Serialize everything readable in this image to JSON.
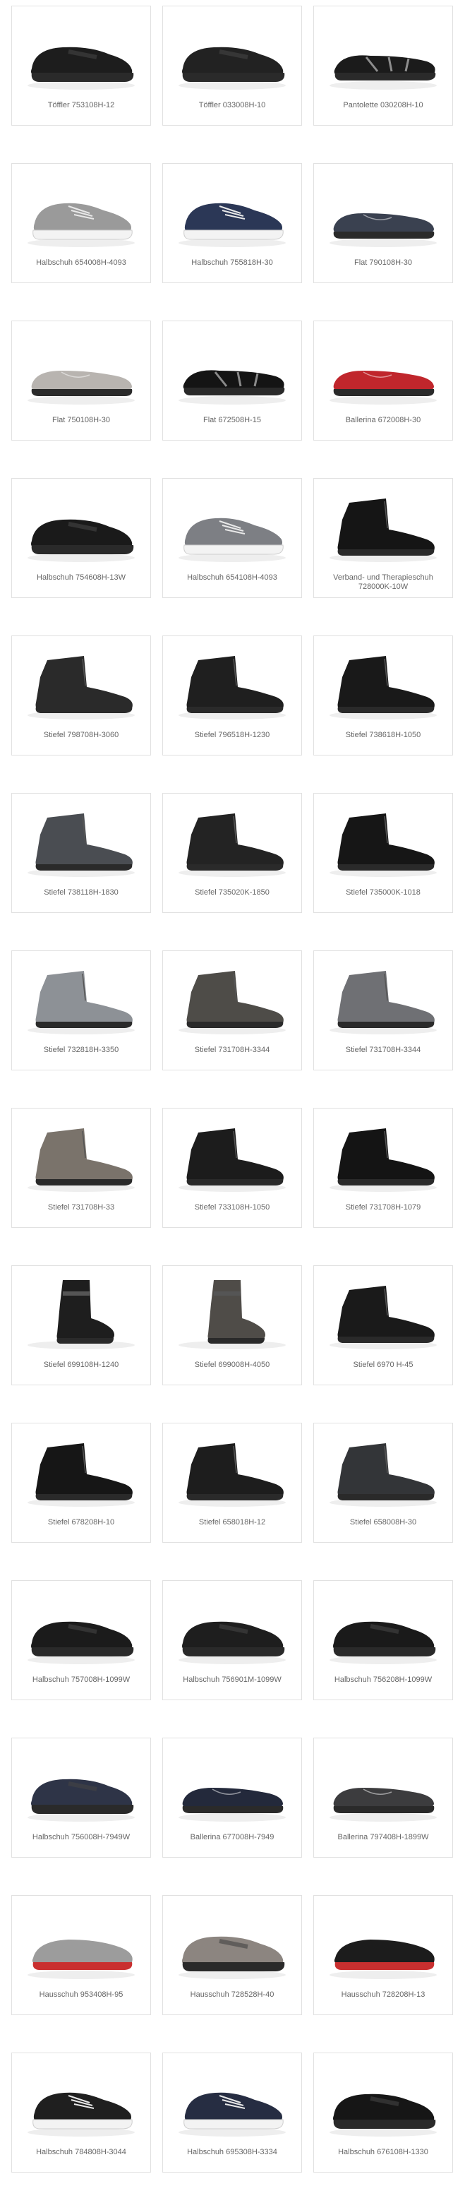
{
  "products": [
    {
      "name": "Töffler 753108H-12",
      "type": "slipon",
      "color": "#1d1d1d"
    },
    {
      "name": "Töffler 033008H-10",
      "type": "slipon",
      "color": "#222222"
    },
    {
      "name": "Pantolette 030208H-10",
      "type": "sandal",
      "color": "#1b1b1b"
    },
    {
      "name": "Halbschuh 654008H-4093",
      "type": "sneaker",
      "color": "#9a9a9a"
    },
    {
      "name": "Halbschuh 755818H-30",
      "type": "sneaker",
      "color": "#2b3756"
    },
    {
      "name": "Flat 790108H-30",
      "type": "flat",
      "color": "#3a4150"
    },
    {
      "name": "Flat 750108H-30",
      "type": "flat",
      "color": "#b8b4b0"
    },
    {
      "name": "Flat 672508H-15",
      "type": "sandal",
      "color": "#141414"
    },
    {
      "name": "Ballerina 672008H-30",
      "type": "flat",
      "color": "#c0262c"
    },
    {
      "name": "Halbschuh 754608H-13W",
      "type": "slipon",
      "color": "#1a1a1a"
    },
    {
      "name": "Halbschuh 654108H-4093",
      "type": "sneaker",
      "color": "#7d7f84"
    },
    {
      "name": "Verband- und Therapieschuh 728000K-10W",
      "type": "boot",
      "color": "#151515"
    },
    {
      "name": "Stiefel 798708H-3060",
      "type": "boot",
      "color": "#2a2a2a"
    },
    {
      "name": "Stiefel 796518H-1230",
      "type": "boot",
      "color": "#1f1f1f"
    },
    {
      "name": "Stiefel 738618H-1050",
      "type": "boot",
      "color": "#191919"
    },
    {
      "name": "Stiefel 738118H-1830",
      "type": "boot",
      "color": "#4a4d52"
    },
    {
      "name": "Stiefel 735020K-1850",
      "type": "boot",
      "color": "#232323"
    },
    {
      "name": "Stiefel 735000K-1018",
      "type": "boot",
      "color": "#161616"
    },
    {
      "name": "Stiefel 732818H-3350",
      "type": "boot",
      "color": "#8d9196"
    },
    {
      "name": "Stiefel 731708H-3344",
      "type": "boot",
      "color": "#4e4c48"
    },
    {
      "name": "Stiefel 731708H-3344",
      "type": "boot",
      "color": "#6f7074"
    },
    {
      "name": "Stiefel 731708H-33",
      "type": "boot",
      "color": "#7a736b"
    },
    {
      "name": "Stiefel 733108H-1050",
      "type": "boot",
      "color": "#1c1c1c"
    },
    {
      "name": "Stiefel 731708H-1079",
      "type": "boot",
      "color": "#141414"
    },
    {
      "name": "Stiefel 699108H-1240",
      "type": "tallboot",
      "color": "#1e1e1e"
    },
    {
      "name": "Stiefel 699008H-4050",
      "type": "tallboot",
      "color": "#4f4c48"
    },
    {
      "name": "Stiefel 6970 H-45",
      "type": "boot",
      "color": "#1a1a1a"
    },
    {
      "name": "Stiefel 678208H-10",
      "type": "boot",
      "color": "#161616"
    },
    {
      "name": "Stiefel 658018H-12",
      "type": "boot",
      "color": "#1d1d1d"
    },
    {
      "name": "Stiefel 658008H-30",
      "type": "boot",
      "color": "#333538"
    },
    {
      "name": "Halbschuh 757008H-1099W",
      "type": "slipon",
      "color": "#1b1b1b"
    },
    {
      "name": "Halbschuh 756901M-1099W",
      "type": "slipon",
      "color": "#1e1e1e"
    },
    {
      "name": "Halbschuh 756208H-1099W",
      "type": "slipon",
      "color": "#1a1a1a"
    },
    {
      "name": "Halbschuh 756008H-7949W",
      "type": "slipon",
      "color": "#2e3447"
    },
    {
      "name": "Ballerina 677008H-7949",
      "type": "flat",
      "color": "#23293b"
    },
    {
      "name": "Ballerina 797408H-1899W",
      "type": "flat",
      "color": "#3c3c3e"
    },
    {
      "name": "Hausschuh 953408H-95",
      "type": "slipper",
      "color": "#9c9c9c"
    },
    {
      "name": "Hausschuh 728528H-40",
      "type": "slipon",
      "color": "#8c8580"
    },
    {
      "name": "Hausschuh 728208H-13",
      "type": "slipper",
      "color": "#1c1c1c"
    },
    {
      "name": "Halbschuh 784808H-3044",
      "type": "sneaker",
      "color": "#1f1f1f"
    },
    {
      "name": "Halbschuh 695308H-3334",
      "type": "sneaker",
      "color": "#262d42"
    },
    {
      "name": "Halbschuh 676108H-1330",
      "type": "slipon",
      "color": "#161616"
    }
  ]
}
